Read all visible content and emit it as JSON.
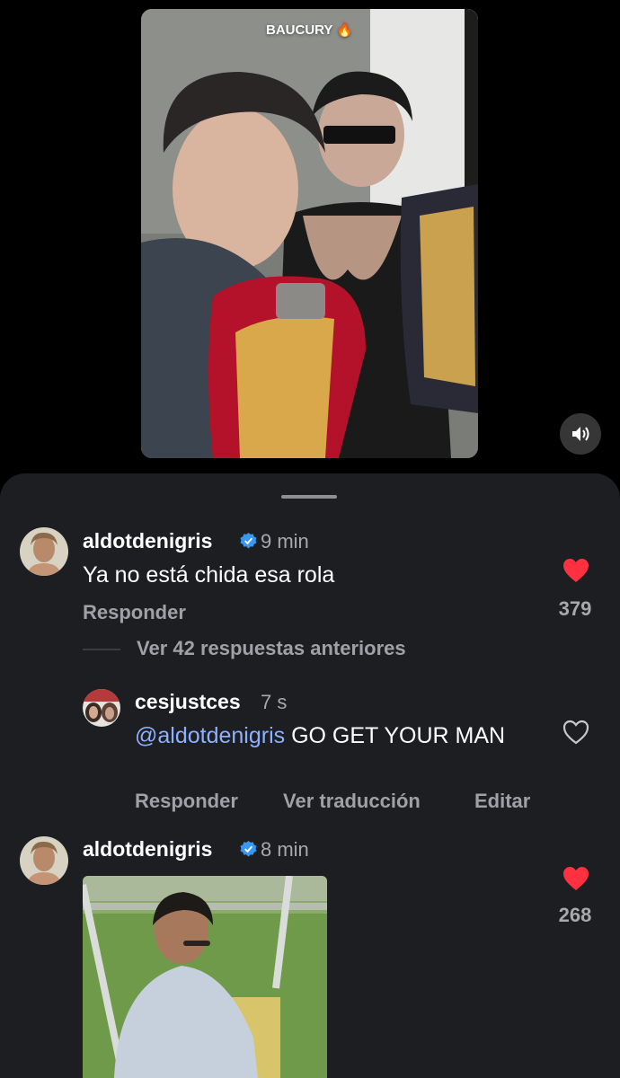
{
  "video": {
    "title": "BAUCURY 🔥",
    "mute_icon": "speaker-icon"
  },
  "comments": [
    {
      "username": "aldotdenigris",
      "verified": true,
      "time": "9 min",
      "text": "Ya no está chida esa rola",
      "reply_label": "Responder",
      "likes": "379",
      "liked": true
    }
  ],
  "view_replies_label": "Ver 42 respuestas anteriores",
  "reply": {
    "username": "cesjustces",
    "time": "7 s",
    "mention": "@aldotdenigris",
    "text": " GO GET YOUR MAN",
    "reply_label": "Responder",
    "translate_label": "Ver traducción",
    "edit_label": "Editar",
    "liked": false
  },
  "comment2": {
    "username": "aldotdenigris",
    "verified": true,
    "time": "8 min",
    "likes": "268",
    "liked": true,
    "attachment": "gif"
  },
  "colors": {
    "like": "#ff3040",
    "verified": "#3897f0",
    "mention": "#8fb0ff",
    "sheet_bg": "#1c1e22"
  }
}
